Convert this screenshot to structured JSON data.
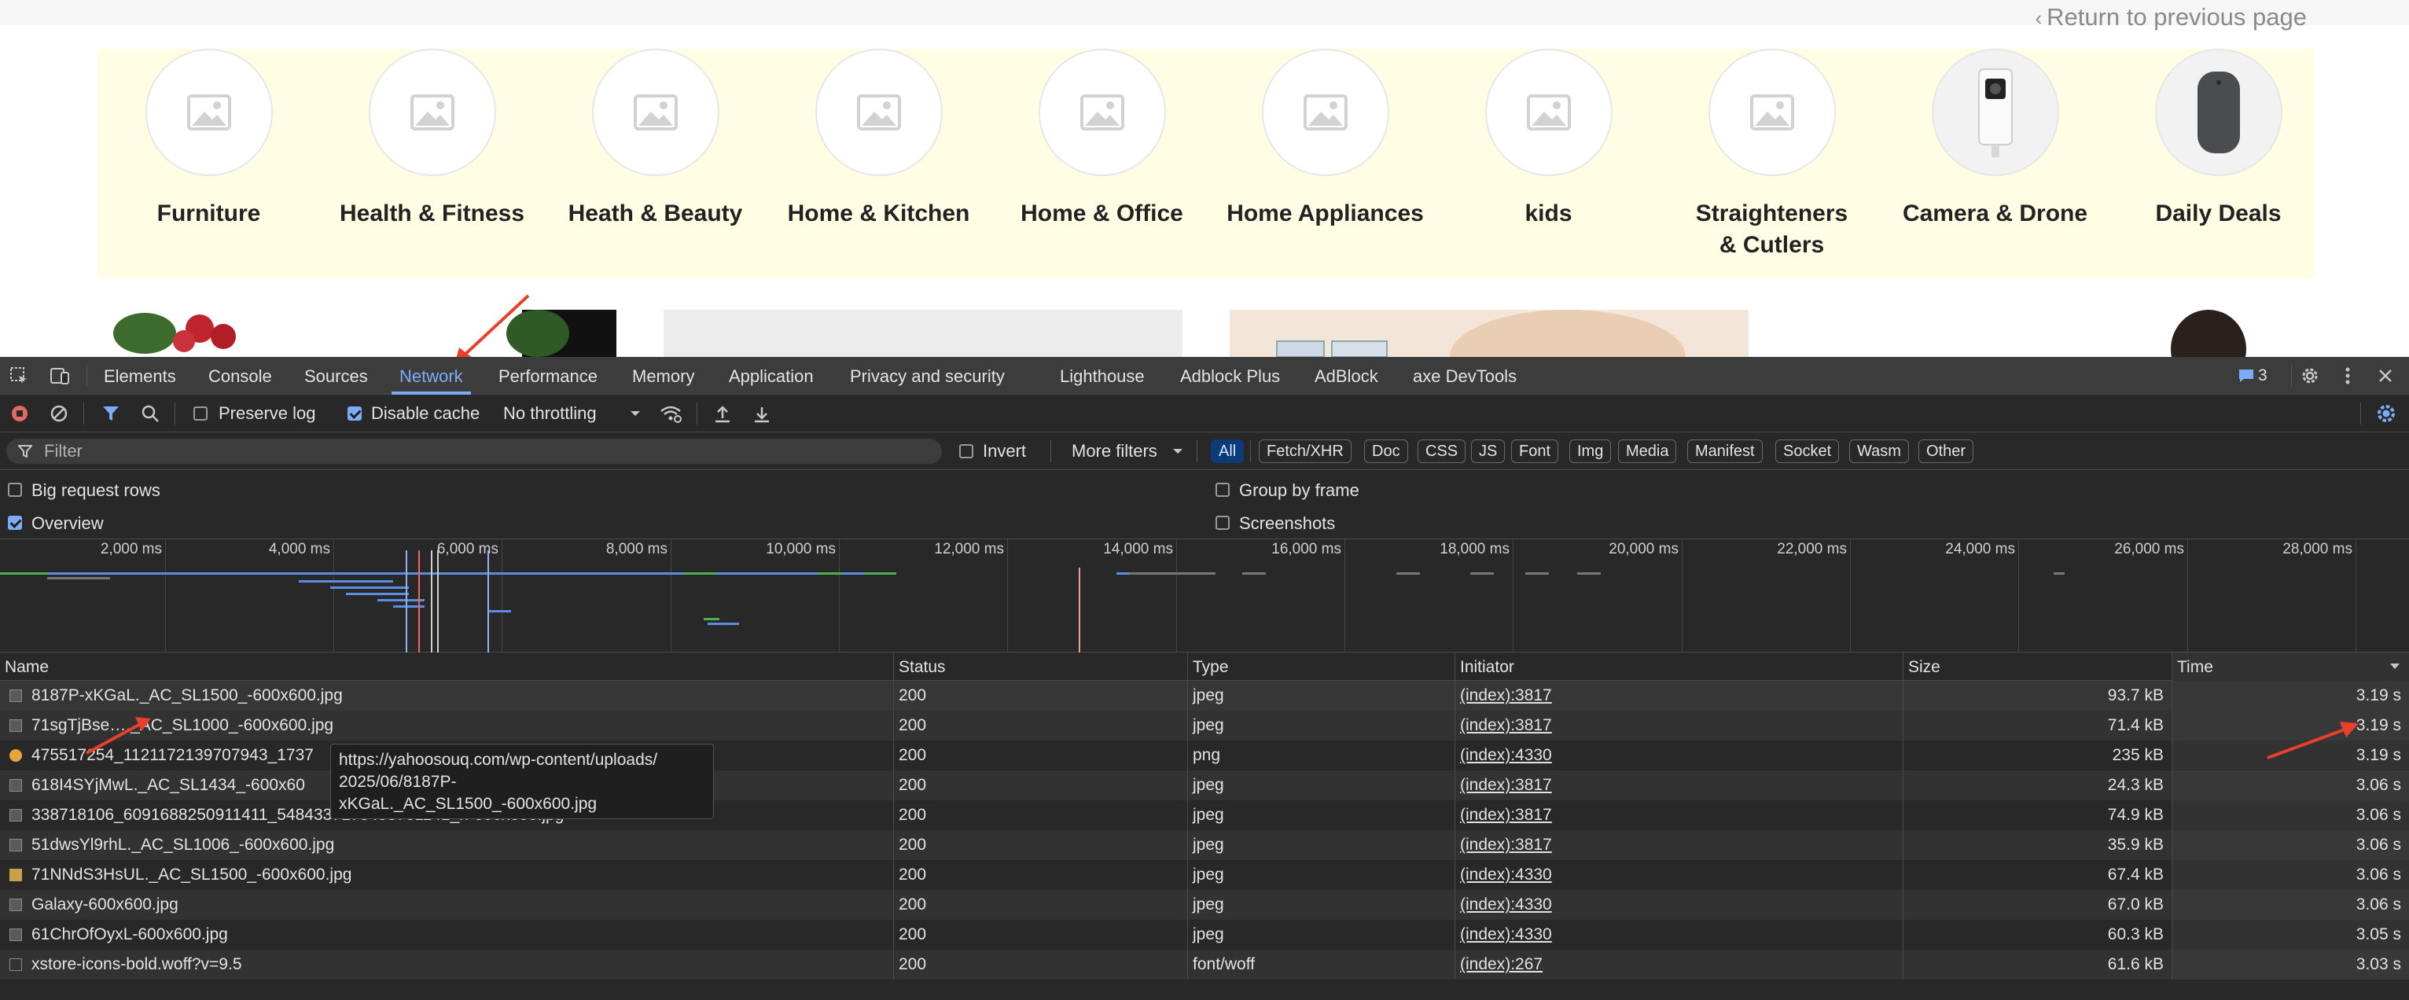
{
  "site": {
    "return_link": "Return to previous page",
    "categories": [
      {
        "label": "Furniture",
        "icon": "image-placeholder-icon"
      },
      {
        "label": "Health & Fitness",
        "icon": "image-placeholder-icon"
      },
      {
        "label": "Heath & Beauty",
        "icon": "image-placeholder-icon"
      },
      {
        "label": "Home & Kitchen",
        "icon": "image-placeholder-icon"
      },
      {
        "label": "Home & Office",
        "icon": "image-placeholder-icon"
      },
      {
        "label": "Home Appliances",
        "icon": "image-placeholder-icon"
      },
      {
        "label": "kids",
        "icon": "image-placeholder-icon"
      },
      {
        "label": "Straighteners & Cutlers",
        "icon": "image-placeholder-icon"
      },
      {
        "label": "Camera & Drone",
        "icon": "security-camera-icon"
      },
      {
        "label": "Daily Deals",
        "icon": "smart-speaker-icon"
      }
    ]
  },
  "devtools": {
    "tabs": [
      "Elements",
      "Console",
      "Sources",
      "Network",
      "Performance",
      "Memory",
      "Application",
      "Privacy and security",
      "Lighthouse",
      "Adblock Plus",
      "AdBlock",
      "axe DevTools"
    ],
    "active_tab": "Network",
    "issues_count": "3",
    "toolbar": {
      "preserve_log": "Preserve log",
      "disable_cache": "Disable cache",
      "throttling": "No throttling"
    },
    "filter": {
      "placeholder": "Filter",
      "invert": "Invert",
      "more_filters": "More filters",
      "types": [
        "All",
        "Fetch/XHR",
        "Doc",
        "CSS",
        "JS",
        "Font",
        "Img",
        "Media",
        "Manifest",
        "Socket",
        "Wasm",
        "Other"
      ],
      "active_type": "All"
    },
    "options": {
      "big_request_rows": "Big request rows",
      "group_by_frame": "Group by frame",
      "overview": "Overview",
      "screenshots": "Screenshots"
    },
    "overview_ticks": [
      "2,000 ms",
      "4,000 ms",
      "6,000 ms",
      "8,000 ms",
      "10,000 ms",
      "12,000 ms",
      "14,000 ms",
      "16,000 ms",
      "18,000 ms",
      "20,000 ms",
      "22,000 ms",
      "24,000 ms",
      "26,000 ms",
      "28,000 ms"
    ],
    "table": {
      "columns": [
        "Name",
        "Status",
        "Type",
        "Initiator",
        "Size",
        "Time"
      ],
      "rows": [
        {
          "name": "8187P-xKGaL._AC_SL1500_-600x600.jpg",
          "status": "200",
          "type": "jpeg",
          "initiator": "(index):3817",
          "size": "93.7 kB",
          "time": "3.19 s"
        },
        {
          "name": "71sgTjBse…._AC_SL1000_-600x600.jpg",
          "status": "200",
          "type": "jpeg",
          "initiator": "(index):3817",
          "size": "71.4 kB",
          "time": "3.19 s"
        },
        {
          "name": "475517254_1121172139707943_1737",
          "status": "200",
          "type": "png",
          "initiator": "(index):4330",
          "size": "235 kB",
          "time": "3.19 s"
        },
        {
          "name": "618I4SYjMwL._AC_SL1434_-600x60",
          "status": "200",
          "type": "jpeg",
          "initiator": "(index):3817",
          "size": "24.3 kB",
          "time": "3.06 s"
        },
        {
          "name": "338718106_6091688250911411_5484337173453761141_n-600x600.jpg",
          "status": "200",
          "type": "jpeg",
          "initiator": "(index):3817",
          "size": "74.9 kB",
          "time": "3.06 s"
        },
        {
          "name": "51dwsYl9rhL._AC_SL1006_-600x600.jpg",
          "status": "200",
          "type": "jpeg",
          "initiator": "(index):3817",
          "size": "35.9 kB",
          "time": "3.06 s"
        },
        {
          "name": "71NNdS3HsUL._AC_SL1500_-600x600.jpg",
          "status": "200",
          "type": "jpeg",
          "initiator": "(index):4330",
          "size": "67.4 kB",
          "time": "3.06 s"
        },
        {
          "name": "Galaxy-600x600.jpg",
          "status": "200",
          "type": "jpeg",
          "initiator": "(index):4330",
          "size": "67.0 kB",
          "time": "3.06 s"
        },
        {
          "name": "61ChrOfOyxL-600x600.jpg",
          "status": "200",
          "type": "jpeg",
          "initiator": "(index):4330",
          "size": "60.3 kB",
          "time": "3.05 s"
        },
        {
          "name": "xstore-icons-bold.woff?v=9.5",
          "status": "200",
          "type": "font/woff",
          "initiator": "(index):267",
          "size": "61.6 kB",
          "time": "3.03 s"
        }
      ]
    },
    "tooltip": {
      "line1": "https://yahoosouq.com/wp-content/uploads/",
      "line2": "2025/06/8187P-",
      "line3": "xKGaL._AC_SL1500_-600x600.jpg"
    },
    "colors": {
      "accent": "#7cacf8",
      "annotation_arrow": "#e8402a",
      "panel_bg": "#282828"
    }
  }
}
